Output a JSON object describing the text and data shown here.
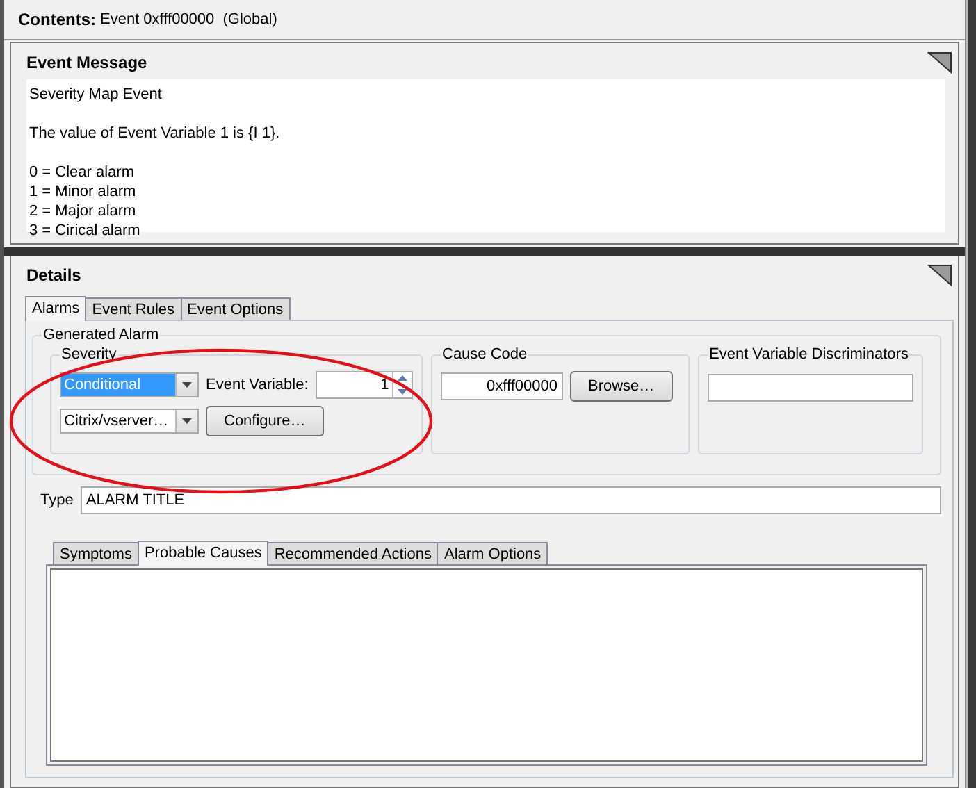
{
  "contents": {
    "label": "Contents:",
    "value": "Event 0xfff00000  (Global)"
  },
  "event_message": {
    "title": "Event Message",
    "paragraphs": [
      {
        "lines": [
          "Severity Map Event"
        ]
      },
      {
        "lines": [
          "The value of Event Variable 1 is {I 1}."
        ]
      },
      {
        "lines": [
          "0 = Clear alarm",
          "1 = Minor alarm",
          "2 = Major alarm",
          "3 = Cirical alarm"
        ]
      }
    ]
  },
  "details": {
    "title": "Details",
    "tabs": [
      {
        "label": "Alarms",
        "selected": true
      },
      {
        "label": "Event Rules",
        "selected": false
      },
      {
        "label": "Event Options",
        "selected": false
      }
    ],
    "generated_alarm": {
      "title": "Generated Alarm",
      "severity": {
        "title": "Severity",
        "mode": "Conditional",
        "variable_label": "Event Variable:",
        "variable_value": "1",
        "map": "Citrix/vserver…",
        "configure_button": "Configure…"
      },
      "cause_code": {
        "title": "Cause Code",
        "value": "0xfff00000",
        "browse_button": "Browse…"
      },
      "discriminators": {
        "title": "Event Variable Discriminators"
      }
    },
    "type": {
      "label": "Type",
      "value": "ALARM TITLE"
    },
    "sub_tabs": [
      {
        "label": "Symptoms",
        "selected": false
      },
      {
        "label": "Probable Causes",
        "selected": true
      },
      {
        "label": "Recommended Actions",
        "selected": false
      },
      {
        "label": "Alarm Options",
        "selected": false
      }
    ]
  },
  "annotation": {
    "kind": "ellipse"
  }
}
